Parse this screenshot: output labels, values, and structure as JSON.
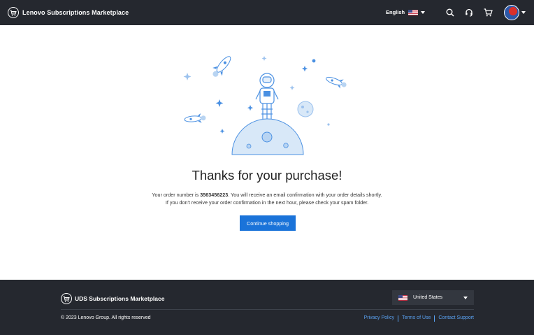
{
  "header": {
    "brand_title": "Lenovo Subscriptions Marketplace",
    "language": "English",
    "icons": [
      "cart-logo-icon",
      "search-icon",
      "headset-icon",
      "cart-icon",
      "avatar",
      "chevron-down-icon"
    ]
  },
  "main": {
    "title": "Thanks for your purchase!",
    "order_prefix": "Your order number is",
    "order_number": "3563456223",
    "order_suffix": ". You will receive an email confirmation with your order details shortly.",
    "spam_notice": "If you don't receive your order confirmation in the next hour, please check your spam folder.",
    "continue_label": "Continue shopping"
  },
  "footer": {
    "brand_title": "UDS Subscriptions Marketplace",
    "country": "United States",
    "copyright": "© 2023 Lenovo Group. All rights reserved",
    "links": {
      "privacy": "Privacy Policy",
      "terms": "Terms of Use",
      "support": "Contact Support"
    }
  },
  "colors": {
    "header_bg": "#25282f",
    "accent": "#1a73d9",
    "illustration": "#4a90e2",
    "link": "#5aa2f2"
  }
}
